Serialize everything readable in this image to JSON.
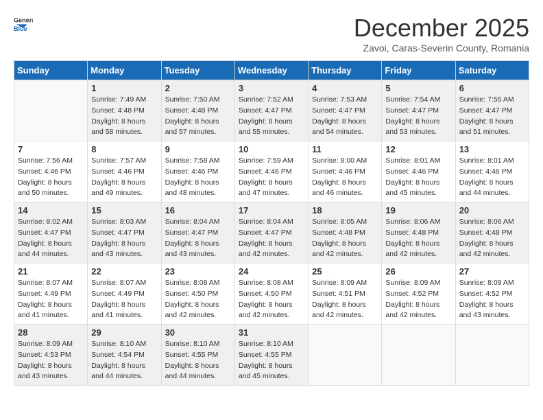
{
  "logo": {
    "general": "General",
    "blue": "Blue"
  },
  "title": "December 2025",
  "subtitle": "Zavoi, Caras-Severin County, Romania",
  "days_header": [
    "Sunday",
    "Monday",
    "Tuesday",
    "Wednesday",
    "Thursday",
    "Friday",
    "Saturday"
  ],
  "weeks": [
    [
      {
        "day": "",
        "info": ""
      },
      {
        "day": "1",
        "info": "Sunrise: 7:49 AM\nSunset: 4:48 PM\nDaylight: 8 hours\nand 58 minutes."
      },
      {
        "day": "2",
        "info": "Sunrise: 7:50 AM\nSunset: 4:48 PM\nDaylight: 8 hours\nand 57 minutes."
      },
      {
        "day": "3",
        "info": "Sunrise: 7:52 AM\nSunset: 4:47 PM\nDaylight: 8 hours\nand 55 minutes."
      },
      {
        "day": "4",
        "info": "Sunrise: 7:53 AM\nSunset: 4:47 PM\nDaylight: 8 hours\nand 54 minutes."
      },
      {
        "day": "5",
        "info": "Sunrise: 7:54 AM\nSunset: 4:47 PM\nDaylight: 8 hours\nand 53 minutes."
      },
      {
        "day": "6",
        "info": "Sunrise: 7:55 AM\nSunset: 4:47 PM\nDaylight: 8 hours\nand 51 minutes."
      }
    ],
    [
      {
        "day": "7",
        "info": "Sunrise: 7:56 AM\nSunset: 4:46 PM\nDaylight: 8 hours\nand 50 minutes."
      },
      {
        "day": "8",
        "info": "Sunrise: 7:57 AM\nSunset: 4:46 PM\nDaylight: 8 hours\nand 49 minutes."
      },
      {
        "day": "9",
        "info": "Sunrise: 7:58 AM\nSunset: 4:46 PM\nDaylight: 8 hours\nand 48 minutes."
      },
      {
        "day": "10",
        "info": "Sunrise: 7:59 AM\nSunset: 4:46 PM\nDaylight: 8 hours\nand 47 minutes."
      },
      {
        "day": "11",
        "info": "Sunrise: 8:00 AM\nSunset: 4:46 PM\nDaylight: 8 hours\nand 46 minutes."
      },
      {
        "day": "12",
        "info": "Sunrise: 8:01 AM\nSunset: 4:46 PM\nDaylight: 8 hours\nand 45 minutes."
      },
      {
        "day": "13",
        "info": "Sunrise: 8:01 AM\nSunset: 4:46 PM\nDaylight: 8 hours\nand 44 minutes."
      }
    ],
    [
      {
        "day": "14",
        "info": "Sunrise: 8:02 AM\nSunset: 4:47 PM\nDaylight: 8 hours\nand 44 minutes."
      },
      {
        "day": "15",
        "info": "Sunrise: 8:03 AM\nSunset: 4:47 PM\nDaylight: 8 hours\nand 43 minutes."
      },
      {
        "day": "16",
        "info": "Sunrise: 8:04 AM\nSunset: 4:47 PM\nDaylight: 8 hours\nand 43 minutes."
      },
      {
        "day": "17",
        "info": "Sunrise: 8:04 AM\nSunset: 4:47 PM\nDaylight: 8 hours\nand 42 minutes."
      },
      {
        "day": "18",
        "info": "Sunrise: 8:05 AM\nSunset: 4:48 PM\nDaylight: 8 hours\nand 42 minutes."
      },
      {
        "day": "19",
        "info": "Sunrise: 8:06 AM\nSunset: 4:48 PM\nDaylight: 8 hours\nand 42 minutes."
      },
      {
        "day": "20",
        "info": "Sunrise: 8:06 AM\nSunset: 4:48 PM\nDaylight: 8 hours\nand 42 minutes."
      }
    ],
    [
      {
        "day": "21",
        "info": "Sunrise: 8:07 AM\nSunset: 4:49 PM\nDaylight: 8 hours\nand 41 minutes."
      },
      {
        "day": "22",
        "info": "Sunrise: 8:07 AM\nSunset: 4:49 PM\nDaylight: 8 hours\nand 41 minutes."
      },
      {
        "day": "23",
        "info": "Sunrise: 8:08 AM\nSunset: 4:50 PM\nDaylight: 8 hours\nand 42 minutes."
      },
      {
        "day": "24",
        "info": "Sunrise: 8:08 AM\nSunset: 4:50 PM\nDaylight: 8 hours\nand 42 minutes."
      },
      {
        "day": "25",
        "info": "Sunrise: 8:09 AM\nSunset: 4:51 PM\nDaylight: 8 hours\nand 42 minutes."
      },
      {
        "day": "26",
        "info": "Sunrise: 8:09 AM\nSunset: 4:52 PM\nDaylight: 8 hours\nand 42 minutes."
      },
      {
        "day": "27",
        "info": "Sunrise: 8:09 AM\nSunset: 4:52 PM\nDaylight: 8 hours\nand 43 minutes."
      }
    ],
    [
      {
        "day": "28",
        "info": "Sunrise: 8:09 AM\nSunset: 4:53 PM\nDaylight: 8 hours\nand 43 minutes."
      },
      {
        "day": "29",
        "info": "Sunrise: 8:10 AM\nSunset: 4:54 PM\nDaylight: 8 hours\nand 44 minutes."
      },
      {
        "day": "30",
        "info": "Sunrise: 8:10 AM\nSunset: 4:55 PM\nDaylight: 8 hours\nand 44 minutes."
      },
      {
        "day": "31",
        "info": "Sunrise: 8:10 AM\nSunset: 4:55 PM\nDaylight: 8 hours\nand 45 minutes."
      },
      {
        "day": "",
        "info": ""
      },
      {
        "day": "",
        "info": ""
      },
      {
        "day": "",
        "info": ""
      }
    ]
  ]
}
